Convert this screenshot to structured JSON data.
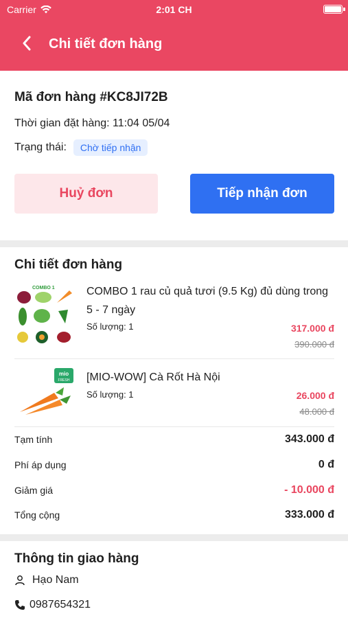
{
  "status_bar": {
    "carrier": "Carrier",
    "time": "2:01 CH"
  },
  "nav": {
    "title": "Chi tiết đơn hàng"
  },
  "order": {
    "code": "Mã đơn hàng #KC8JI72B",
    "time": "Thời gian đặt hàng: 11:04 05/04",
    "status_label": "Trạng thái:",
    "status_value": "Chờ tiếp nhận",
    "cancel_label": "Huỷ đơn",
    "accept_label": "Tiếp nhận đơn"
  },
  "details": {
    "title": "Chi tiết đơn hàng",
    "products": [
      {
        "name": "COMBO 1 rau củ quả tươi (9.5 Kg) đủ dùng trong 5 - 7 ngày",
        "quantity": "Số lượng: 1",
        "price": "317.000 đ",
        "old_price": "390.000 đ",
        "image_label": "COMBO 1"
      },
      {
        "name": "[MIO-WOW] Cà Rốt Hà Nội",
        "quantity": "Số lượng: 1",
        "price": "26.000 đ",
        "old_price": "48.000 đ",
        "image_label": "mio",
        "image_sublabel": "FRESH"
      }
    ],
    "summary": [
      {
        "label": "Tạm tính",
        "value": "343.000 đ"
      },
      {
        "label": "Phí áp dụng",
        "value": "0 đ"
      },
      {
        "label": "Giảm giá",
        "value": "- 10.000 đ"
      },
      {
        "label": "Tổng cộng",
        "value": "333.000 đ"
      }
    ]
  },
  "delivery": {
    "title": "Thông tin giao hàng",
    "name": "Hạo Nam",
    "phone": "0987654321"
  },
  "colors": {
    "brand": "#ea4762",
    "accept": "#2f70f2",
    "badge_bg": "#e6efff",
    "badge_text": "#2f6ff3",
    "price": "#e9465f"
  }
}
